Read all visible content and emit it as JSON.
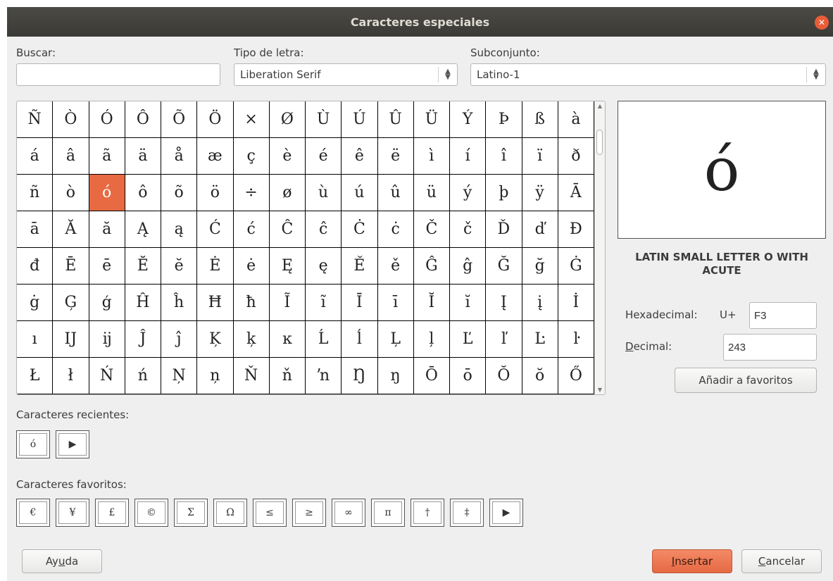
{
  "dialog": {
    "title": "Caracteres especiales"
  },
  "search": {
    "label": "Buscar:",
    "value": ""
  },
  "font": {
    "label": "Tipo de letra:",
    "value": "Liberation Serif"
  },
  "subset": {
    "label": "Subconjunto:",
    "value": "Latino-1"
  },
  "grid": {
    "rows": [
      [
        "Ñ",
        "Ò",
        "Ó",
        "Ô",
        "Õ",
        "Ö",
        "×",
        "Ø",
        "Ù",
        "Ú",
        "Û",
        "Ü",
        "Ý",
        "Þ",
        "ß",
        "à"
      ],
      [
        "á",
        "â",
        "ã",
        "ä",
        "å",
        "æ",
        "ç",
        "è",
        "é",
        "ê",
        "ë",
        "ì",
        "í",
        "î",
        "ï",
        "ð"
      ],
      [
        "ñ",
        "ò",
        "ó",
        "ô",
        "õ",
        "ö",
        "÷",
        "ø",
        "ù",
        "ú",
        "û",
        "ü",
        "ý",
        "þ",
        "ÿ",
        "Ā"
      ],
      [
        "ā",
        "Ă",
        "ă",
        "Ą",
        "ą",
        "Ć",
        "ć",
        "Ĉ",
        "ĉ",
        "Ċ",
        "ċ",
        "Č",
        "č",
        "Ď",
        "ď",
        "Đ"
      ],
      [
        "đ",
        "Ē",
        "ē",
        "Ĕ",
        "ĕ",
        "Ė",
        "ė",
        "Ę",
        "ę",
        "Ě",
        "ě",
        "Ĝ",
        "ĝ",
        "Ğ",
        "ğ",
        "Ġ"
      ],
      [
        "ġ",
        "Ģ",
        "ģ",
        "Ĥ",
        "ĥ",
        "Ħ",
        "ħ",
        "Ĩ",
        "ĩ",
        "Ī",
        "ī",
        "Ĭ",
        "ĭ",
        "Į",
        "į",
        "İ"
      ],
      [
        "ı",
        "Ĳ",
        "ĳ",
        "Ĵ",
        "ĵ",
        "Ķ",
        "ķ",
        "ĸ",
        "Ĺ",
        "ĺ",
        "Ļ",
        "ļ",
        "Ľ",
        "ľ",
        "Ŀ",
        "ŀ"
      ],
      [
        "Ł",
        "ł",
        "Ń",
        "ń",
        "Ņ",
        "ņ",
        "Ň",
        "ň",
        "ŉ",
        "Ŋ",
        "ŋ",
        "Ō",
        "ō",
        "Ŏ",
        "ŏ",
        "Ő"
      ]
    ],
    "selected_char": "ó"
  },
  "preview": {
    "char": "ó",
    "name": "LATIN SMALL LETTER O WITH ACUTE"
  },
  "hex": {
    "label": "Hexadecimal:",
    "prefix": "U+",
    "value": "F3"
  },
  "decimal": {
    "label": "Decimal:",
    "value": "243"
  },
  "add_favorite_label": "Añadir a favoritos",
  "recent": {
    "label": "Caracteres recientes:",
    "items": [
      "ó",
      "▶"
    ]
  },
  "favorites": {
    "label": "Caracteres favoritos:",
    "items": [
      "€",
      "¥",
      "£",
      "©",
      "Σ",
      "Ω",
      "≤",
      "≥",
      "∞",
      "π",
      "†",
      "‡",
      "▶"
    ]
  },
  "buttons": {
    "help": "Ayuda",
    "insert": "Insertar",
    "cancel": "Cancelar"
  },
  "colors": {
    "accent": "#e76a43",
    "titlebar": "#3b3a36",
    "close": "#e95c38"
  }
}
